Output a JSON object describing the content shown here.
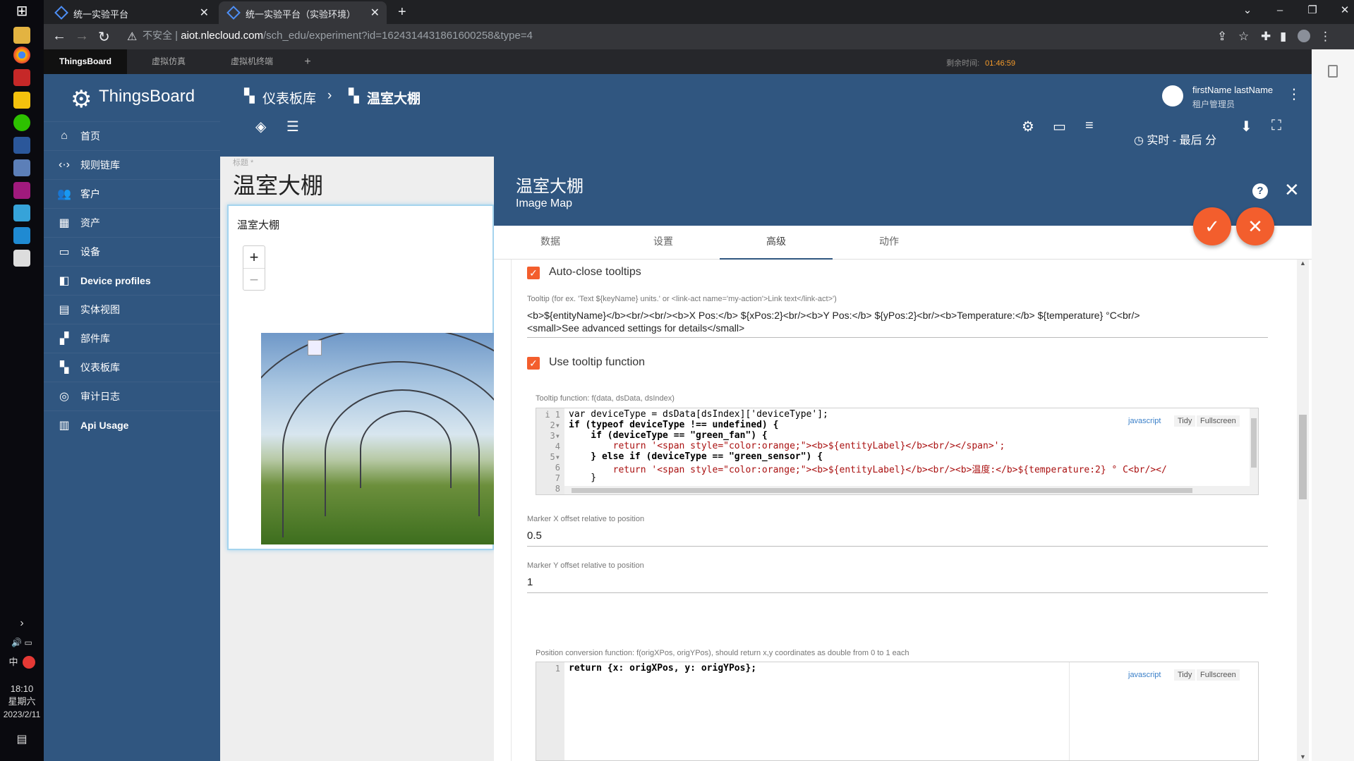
{
  "taskbar": {
    "clock_time": "18:10",
    "clock_day": "星期六",
    "clock_date": "2023/2/11",
    "ime": "中"
  },
  "browser": {
    "tabs": [
      {
        "title": "统一实验平台"
      },
      {
        "title": "统一实验平台（实验环境）"
      }
    ],
    "security_label": "不安全",
    "url_host": "aiot.nlecloud.com",
    "url_path": "/sch_edu/experiment?id=1624314431861600258&type=4"
  },
  "platform": {
    "tabs": [
      "ThingsBoard",
      "虚拟仿真",
      "虚拟机终端"
    ],
    "remaining_label": "剩余时间:",
    "remaining_time": "01:46:59"
  },
  "tb": {
    "logo": "ThingsBoard",
    "menu": [
      {
        "label": "首页",
        "icon": "home-icon"
      },
      {
        "label": "规则链库",
        "icon": "rule-chain-icon"
      },
      {
        "label": "客户",
        "icon": "customers-icon"
      },
      {
        "label": "资产",
        "icon": "assets-icon"
      },
      {
        "label": "设备",
        "icon": "devices-icon"
      },
      {
        "label": "Device profiles",
        "icon": "device-profile-icon"
      },
      {
        "label": "实体视图",
        "icon": "entity-view-icon"
      },
      {
        "label": "部件库",
        "icon": "widgets-icon"
      },
      {
        "label": "仪表板库",
        "icon": "dashboards-icon"
      },
      {
        "label": "审计日志",
        "icon": "audit-icon"
      },
      {
        "label": "Api Usage",
        "icon": "api-usage-icon"
      }
    ],
    "breadcrumb": [
      "仪表板库",
      "温室大棚"
    ],
    "user_name": "firstName lastName",
    "user_role": "租户管理员",
    "realtime": "实时 - 最后 分"
  },
  "dashboard": {
    "hint": "标题 *",
    "title": "温室大棚",
    "widget_title": "温室大棚"
  },
  "dialog": {
    "title": "温室大棚",
    "subtitle": "Image Map",
    "tabs": [
      "数据",
      "设置",
      "高级",
      "动作"
    ],
    "active_tab": "高级",
    "auto_close_label": "Auto-close tooltips",
    "tooltip_label": "Tooltip (for ex. 'Text ${keyName} units.' or <link-act name='my-action'>Link text</link-act>')",
    "tooltip_line1": "<b>${entityName}</b><br/><br/><b>X Pos:</b> ${xPos:2}<br/><b>Y Pos:</b> ${yPos:2}<br/><b>Temperature:</b> ${temperature} °C<br/>",
    "tooltip_line2": "<small>See advanced settings for details</small>",
    "use_tooltip_fn_label": "Use tooltip function",
    "tooltip_fn_label": "Tooltip function: f(data, dsData, dsIndex)",
    "editor_mode": "javascript",
    "tidy": "Tidy",
    "fullscreen": "Fullscreen",
    "code_lines": [
      "var deviceType = dsData[dsIndex]['deviceType'];",
      "if (typeof deviceType !== undefined) {",
      "    if (deviceType == \"green_fan\") {",
      "        return '<span style=\"color:orange;\"><b>${entityLabel}</b><br/></span>';",
      "    } else if (deviceType == \"green_sensor\") {",
      "        return '<span style=\"color:orange;\"><b>${entityLabel}</b><br/><b>温度:</b>${temperature:2} ° C<br/></",
      "    }",
      ""
    ],
    "marker_x_label": "Marker X offset relative to position",
    "marker_x_value": "0.5",
    "marker_y_label": "Marker Y offset relative to position",
    "marker_y_value": "1",
    "position_fn_label": "Position conversion function: f(origXPos, origYPos), should return x,y coordinates as double from 0 to 1 each",
    "position_code": "return {x: origXPos, y: origYPos};"
  }
}
